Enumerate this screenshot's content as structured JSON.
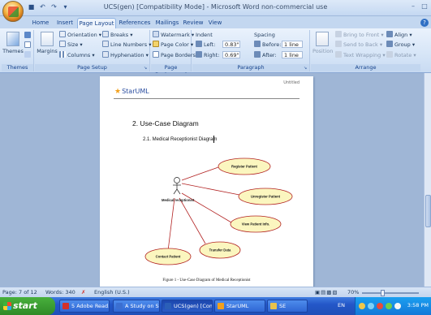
{
  "titlebar": {
    "title": "UCS(gen) [Compatibility Mode] - Microsoft Word non-commercial use",
    "qat_icons": [
      "save-icon",
      "undo-icon",
      "redo-icon"
    ]
  },
  "tabs": [
    "Home",
    "Insert",
    "Page Layout",
    "References",
    "Mailings",
    "Review",
    "View"
  ],
  "active_tab": "Page Layout",
  "ribbon": {
    "themes": {
      "themes_label": "Themes",
      "group_label": "Themes"
    },
    "page_setup": {
      "margins": "Margins",
      "orientation": "Orientation",
      "size": "Size",
      "columns": "Columns",
      "breaks": "Breaks",
      "line_numbers": "Line Numbers",
      "hyphenation": "Hyphenation",
      "group_label": "Page Setup"
    },
    "page_background": {
      "watermark": "Watermark",
      "page_color": "Page Color",
      "page_borders": "Page Borders",
      "group_label": "Page Background"
    },
    "paragraph": {
      "indent_label": "Indent",
      "left_label": "Left:",
      "left_value": "0.83\"",
      "right_label": "Right:",
      "right_value": "0.69\"",
      "spacing_label": "Spacing",
      "before_label": "Before:",
      "before_value": "1 line",
      "after_label": "After:",
      "after_value": "1 line",
      "group_label": "Paragraph"
    },
    "arrange": {
      "position": "Position",
      "bring_to_front": "Bring to Front",
      "send_to_back": "Send to Back",
      "text_wrapping": "Text Wrapping",
      "align": "Align",
      "group": "Group",
      "rotate": "Rotate",
      "group_label": "Arrange"
    }
  },
  "document": {
    "header_logo": "StarUML",
    "header_right": "Untitled",
    "heading2": "2.  Use-Case  Diagram",
    "heading3": "2.1.   Medical  Receptionist  Diagram",
    "actor_label": "Medical receptionist",
    "use_cases": [
      "Register Patient",
      "Unregister Patient",
      "View Patient Info.",
      "Transfer Data",
      "Contact Patient"
    ],
    "caption": "Figure 1 - Use-Case Diagram of Medical Receptionist"
  },
  "statusbar": {
    "page": "Page: 7 of 12",
    "words": "Words: 340",
    "language": "English (U.S.)",
    "zoom": "70%",
    "zoom_fraction": 0.35
  },
  "taskbar": {
    "start": "start",
    "tasks": [
      {
        "label": "5 Adobe Read...",
        "color": "#d4312a"
      },
      {
        "label": "A Study on Star...",
        "color": "#3b6fd1"
      },
      {
        "label": "UCS(gen) [Comp...",
        "color": "#2b5fb8"
      },
      {
        "label": "StarUML",
        "color": "#f2a01c"
      },
      {
        "label": "SE",
        "color": "#e8c24c"
      }
    ],
    "active_task": 2,
    "language": "EN",
    "clock": "3:58 PM"
  },
  "colors": {
    "use_case_fill": "#fbf6bf",
    "use_case_stroke": "#b22222",
    "association": "#b22222"
  }
}
